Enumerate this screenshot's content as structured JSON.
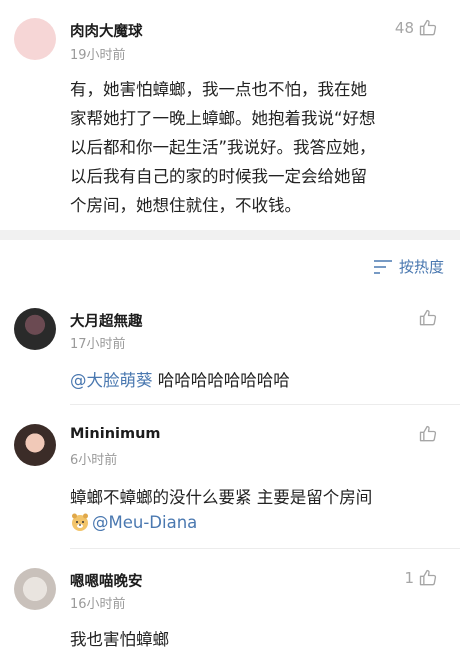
{
  "top_comment": {
    "username": "肉肉大魔球",
    "time": "19小时前",
    "likes": "48",
    "lines": [
      "有，她害怕蟑螂，我一点也不怕，我在她",
      "家帮她打了一晚上蟑螂。她抱着我说“好想",
      "以后都和你一起生活”我说好。我答应她，",
      "以后我有自己的家的时候我一定会给她留",
      "个房间，她想住就住，不收钱。"
    ]
  },
  "sort": {
    "label": "按热度"
  },
  "replies": [
    {
      "username": "大月超無趣",
      "time": "17小时前",
      "mention": "@大脸萌葵",
      "text": " 哈哈哈哈哈哈哈哈",
      "likes": ""
    },
    {
      "username": "Mininimum",
      "time": "6小时前",
      "line1": "蟑螂不蟑螂的没什么要紧  主要是留个房间",
      "mention": "@Meu-Diana",
      "likes": ""
    },
    {
      "username": "嗯嗯喵晚安",
      "time": "16小时前",
      "text": "我也害怕蟑螂",
      "likes": "1"
    }
  ],
  "colors": {
    "link": "#4a78b0",
    "meta": "#9a9a9a",
    "divider_band": "#f1f1f1"
  }
}
